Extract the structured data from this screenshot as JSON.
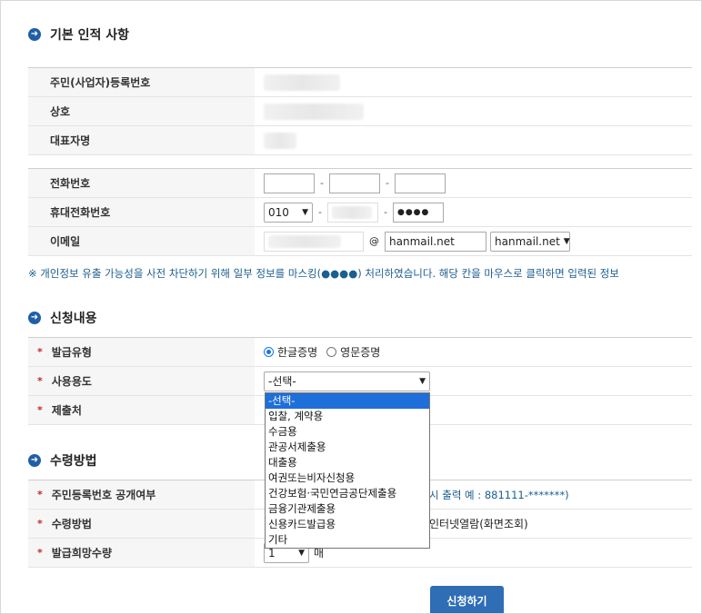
{
  "sections": {
    "basic_title": "기본 인적 사항",
    "request_title": "신청내용",
    "receive_title": "수령방법"
  },
  "basic": {
    "labels": [
      "주민(사업자)등록번호",
      "상호",
      "대표자명"
    ]
  },
  "contact": {
    "phone_label": "전화번호",
    "mobile_label": "휴대전화번호",
    "mobile_prefix": "010",
    "mobile_last": "●●●●",
    "email_label": "이메일",
    "email_at": "@",
    "email_domain": "hanmail.net",
    "email_domain_select": "hanmail.net"
  },
  "notice": "※ 개인정보 유출 가능성을 사전 차단하기 위해 일부 정보를 마스킹(●●●●) 처리하였습니다. 해당 칸을 마우스로 클릭하면 입력된 정보",
  "request": {
    "issue_type_label": "발급유형",
    "korean_option": "한글증명",
    "english_option": "영문증명",
    "purpose_label": "사용용도",
    "purpose_selected": "-선택-",
    "submit_to_label": "제출처"
  },
  "dropdown_options": [
    "-선택-",
    "입찰, 계약용",
    "수금용",
    "관공서제출용",
    "대출용",
    "여권또는비자신청용",
    "건강보험·국민연금공단제출용",
    "금융기관제출용",
    "신용카드발급용",
    "기타"
  ],
  "receive": {
    "disclose_label": "주민등록번호 공개여부",
    "disclose_note": "시 출력 예 : 881111-*******)",
    "method_label": "수령방법",
    "method_note": "인터넷열람(화면조회)",
    "quantity_label": "발급희망수량",
    "quantity_value": "1",
    "quantity_unit": "매"
  },
  "submit_label": "신청하기",
  "colors": {
    "accent": "#1f5fa8",
    "required": "#c62828",
    "notice": "#1b5e8f",
    "highlight": "#1e6fd9"
  }
}
